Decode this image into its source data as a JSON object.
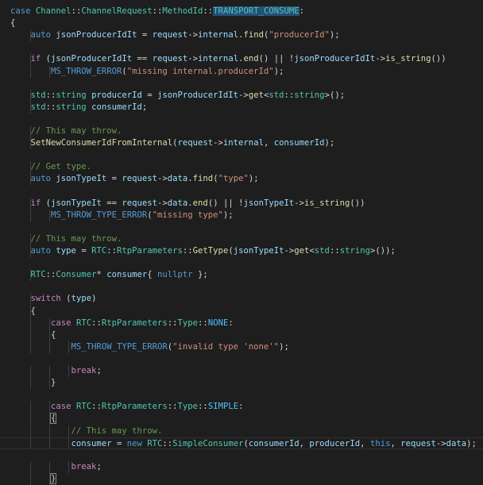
{
  "editor": {
    "language": "cpp",
    "theme": "dark",
    "selected_token": "TRANSPORT_CONSUME",
    "colors": {
      "background": "#1e1e1e",
      "keyword": "#569cd6",
      "control": "#c586c0",
      "type": "#4ec9b0",
      "function": "#dcdcaa",
      "variable": "#9cdcfe",
      "string": "#ce9178",
      "comment": "#6a9955",
      "enum": "#4fc1ff",
      "selection": "#264f78"
    },
    "lines": [
      {
        "indent": 0,
        "tokens": [
          [
            "kw",
            "case"
          ],
          [
            "p",
            " "
          ],
          [
            "type",
            "Channel"
          ],
          [
            "p",
            "::"
          ],
          [
            "type",
            "ChannelRequest"
          ],
          [
            "p",
            "::"
          ],
          [
            "type",
            "MethodId"
          ],
          [
            "p",
            "::"
          ],
          [
            "sel",
            "TRANSPORT_CONSUME"
          ],
          [
            "p",
            ":"
          ]
        ]
      },
      {
        "indent": 0,
        "tokens": [
          [
            "p",
            "{"
          ]
        ]
      },
      {
        "indent": 1,
        "tokens": [
          [
            "kw",
            "auto"
          ],
          [
            "p",
            " "
          ],
          [
            "var",
            "jsonProducerIdIt"
          ],
          [
            "p",
            " = "
          ],
          [
            "var",
            "request"
          ],
          [
            "p",
            "->"
          ],
          [
            "var",
            "internal"
          ],
          [
            "p",
            "."
          ],
          [
            "fn",
            "find"
          ],
          [
            "p",
            "("
          ],
          [
            "str",
            "\"producerId\""
          ],
          [
            "p",
            ");"
          ]
        ]
      },
      {
        "indent": 0,
        "tokens": []
      },
      {
        "indent": 1,
        "tokens": [
          [
            "ctl",
            "if"
          ],
          [
            "p",
            " ("
          ],
          [
            "var",
            "jsonProducerIdIt"
          ],
          [
            "p",
            " == "
          ],
          [
            "var",
            "request"
          ],
          [
            "p",
            "->"
          ],
          [
            "var",
            "internal"
          ],
          [
            "p",
            "."
          ],
          [
            "fn",
            "end"
          ],
          [
            "p",
            "() || !"
          ],
          [
            "var",
            "jsonProducerIdIt"
          ],
          [
            "p",
            "->"
          ],
          [
            "fn",
            "is_string"
          ],
          [
            "p",
            "())"
          ]
        ]
      },
      {
        "indent": 2,
        "tokens": [
          [
            "macro",
            "MS_THROW_ERROR"
          ],
          [
            "p",
            "("
          ],
          [
            "str",
            "\"missing internal.producerId\""
          ],
          [
            "p",
            ");"
          ]
        ]
      },
      {
        "indent": 0,
        "tokens": []
      },
      {
        "indent": 1,
        "tokens": [
          [
            "type",
            "std"
          ],
          [
            "p",
            "::"
          ],
          [
            "type",
            "string"
          ],
          [
            "p",
            " "
          ],
          [
            "var",
            "producerId"
          ],
          [
            "p",
            " = "
          ],
          [
            "var",
            "jsonProducerIdIt"
          ],
          [
            "p",
            "->"
          ],
          [
            "fn",
            "get"
          ],
          [
            "p",
            "<"
          ],
          [
            "type",
            "std"
          ],
          [
            "p",
            "::"
          ],
          [
            "type",
            "string"
          ],
          [
            "p",
            ">();"
          ]
        ]
      },
      {
        "indent": 1,
        "tokens": [
          [
            "type",
            "std"
          ],
          [
            "p",
            "::"
          ],
          [
            "type",
            "string"
          ],
          [
            "p",
            " "
          ],
          [
            "var",
            "consumerId"
          ],
          [
            "p",
            ";"
          ]
        ]
      },
      {
        "indent": 0,
        "tokens": []
      },
      {
        "indent": 1,
        "tokens": [
          [
            "cmt",
            "// This may throw."
          ]
        ]
      },
      {
        "indent": 1,
        "tokens": [
          [
            "fn",
            "SetNewConsumerIdFromInternal"
          ],
          [
            "p",
            "("
          ],
          [
            "var",
            "request"
          ],
          [
            "p",
            "->"
          ],
          [
            "var",
            "internal"
          ],
          [
            "p",
            ", "
          ],
          [
            "var",
            "consumerId"
          ],
          [
            "p",
            ");"
          ]
        ]
      },
      {
        "indent": 0,
        "tokens": []
      },
      {
        "indent": 1,
        "tokens": [
          [
            "cmt",
            "// Get type."
          ]
        ]
      },
      {
        "indent": 1,
        "tokens": [
          [
            "kw",
            "auto"
          ],
          [
            "p",
            " "
          ],
          [
            "var",
            "jsonTypeIt"
          ],
          [
            "p",
            " = "
          ],
          [
            "var",
            "request"
          ],
          [
            "p",
            "->"
          ],
          [
            "var",
            "data"
          ],
          [
            "p",
            "."
          ],
          [
            "fn",
            "find"
          ],
          [
            "p",
            "("
          ],
          [
            "str",
            "\"type\""
          ],
          [
            "p",
            ");"
          ]
        ]
      },
      {
        "indent": 0,
        "tokens": []
      },
      {
        "indent": 1,
        "tokens": [
          [
            "ctl",
            "if"
          ],
          [
            "p",
            " ("
          ],
          [
            "var",
            "jsonTypeIt"
          ],
          [
            "p",
            " == "
          ],
          [
            "var",
            "request"
          ],
          [
            "p",
            "->"
          ],
          [
            "var",
            "data"
          ],
          [
            "p",
            "."
          ],
          [
            "fn",
            "end"
          ],
          [
            "p",
            "() || !"
          ],
          [
            "var",
            "jsonTypeIt"
          ],
          [
            "p",
            "->"
          ],
          [
            "fn",
            "is_string"
          ],
          [
            "p",
            "())"
          ]
        ]
      },
      {
        "indent": 2,
        "tokens": [
          [
            "macro",
            "MS_THROW_TYPE_ERROR"
          ],
          [
            "p",
            "("
          ],
          [
            "str",
            "\"missing type\""
          ],
          [
            "p",
            ");"
          ]
        ]
      },
      {
        "indent": 0,
        "tokens": []
      },
      {
        "indent": 1,
        "tokens": [
          [
            "cmt",
            "// This may throw."
          ]
        ]
      },
      {
        "indent": 1,
        "tokens": [
          [
            "kw",
            "auto"
          ],
          [
            "p",
            " "
          ],
          [
            "var",
            "type"
          ],
          [
            "p",
            " = "
          ],
          [
            "type",
            "RTC"
          ],
          [
            "p",
            "::"
          ],
          [
            "type",
            "RtpParameters"
          ],
          [
            "p",
            "::"
          ],
          [
            "fn",
            "GetType"
          ],
          [
            "p",
            "("
          ],
          [
            "var",
            "jsonTypeIt"
          ],
          [
            "p",
            "->"
          ],
          [
            "fn",
            "get"
          ],
          [
            "p",
            "<"
          ],
          [
            "type",
            "std"
          ],
          [
            "p",
            "::"
          ],
          [
            "type",
            "string"
          ],
          [
            "p",
            ">());"
          ]
        ]
      },
      {
        "indent": 0,
        "tokens": []
      },
      {
        "indent": 1,
        "tokens": [
          [
            "type",
            "RTC"
          ],
          [
            "p",
            "::"
          ],
          [
            "type",
            "Consumer"
          ],
          [
            "p",
            "* "
          ],
          [
            "var",
            "consumer"
          ],
          [
            "p",
            "{ "
          ],
          [
            "kw",
            "nullptr"
          ],
          [
            "p",
            " };"
          ]
        ]
      },
      {
        "indent": 0,
        "tokens": []
      },
      {
        "indent": 1,
        "tokens": [
          [
            "ctl",
            "switch"
          ],
          [
            "p",
            " ("
          ],
          [
            "var",
            "type"
          ],
          [
            "p",
            ")"
          ]
        ]
      },
      {
        "indent": 1,
        "tokens": [
          [
            "p",
            "{"
          ]
        ]
      },
      {
        "indent": 2,
        "tokens": [
          [
            "ctl",
            "case"
          ],
          [
            "p",
            " "
          ],
          [
            "type",
            "RTC"
          ],
          [
            "p",
            "::"
          ],
          [
            "type",
            "RtpParameters"
          ],
          [
            "p",
            "::"
          ],
          [
            "type",
            "Type"
          ],
          [
            "p",
            "::"
          ],
          [
            "enum",
            "NONE"
          ],
          [
            "p",
            ":"
          ]
        ]
      },
      {
        "indent": 2,
        "tokens": [
          [
            "p",
            "{"
          ]
        ]
      },
      {
        "indent": 3,
        "tokens": [
          [
            "macro",
            "MS_THROW_TYPE_ERROR"
          ],
          [
            "p",
            "("
          ],
          [
            "str",
            "\"invalid type 'none'\""
          ],
          [
            "p",
            ");"
          ]
        ]
      },
      {
        "indent": 0,
        "tokens": []
      },
      {
        "indent": 3,
        "tokens": [
          [
            "ctl",
            "break"
          ],
          [
            "p",
            ";"
          ]
        ]
      },
      {
        "indent": 2,
        "tokens": [
          [
            "p",
            "}"
          ]
        ]
      },
      {
        "indent": 0,
        "tokens": []
      },
      {
        "indent": 2,
        "tokens": [
          [
            "ctl",
            "case"
          ],
          [
            "p",
            " "
          ],
          [
            "type",
            "RTC"
          ],
          [
            "p",
            "::"
          ],
          [
            "type",
            "RtpParameters"
          ],
          [
            "p",
            "::"
          ],
          [
            "type",
            "Type"
          ],
          [
            "p",
            "::"
          ],
          [
            "enum",
            "SIMPLE"
          ],
          [
            "p",
            ":"
          ]
        ]
      },
      {
        "indent": 2,
        "tokens": [
          [
            "bm",
            "{"
          ]
        ]
      },
      {
        "indent": 3,
        "tokens": [
          [
            "cmt",
            "// This may throw."
          ]
        ]
      },
      {
        "indent": 3,
        "tokens": [
          [
            "var",
            "consumer"
          ],
          [
            "p",
            " = "
          ],
          [
            "kw",
            "new"
          ],
          [
            "p",
            " "
          ],
          [
            "type",
            "RTC"
          ],
          [
            "p",
            "::"
          ],
          [
            "type",
            "SimpleConsumer"
          ],
          [
            "p",
            "("
          ],
          [
            "var",
            "consumerId"
          ],
          [
            "p",
            ", "
          ],
          [
            "var",
            "producerId"
          ],
          [
            "p",
            ", "
          ],
          [
            "kw",
            "this"
          ],
          [
            "p",
            ", "
          ],
          [
            "var",
            "request"
          ],
          [
            "p",
            "->"
          ],
          [
            "var",
            "data"
          ],
          [
            "p",
            ");"
          ]
        ]
      },
      {
        "indent": 0,
        "tokens": []
      },
      {
        "indent": 3,
        "tokens": [
          [
            "ctl",
            "break"
          ],
          [
            "p",
            ";"
          ]
        ]
      },
      {
        "indent": 2,
        "tokens": [
          [
            "bm",
            "}"
          ]
        ]
      }
    ]
  }
}
